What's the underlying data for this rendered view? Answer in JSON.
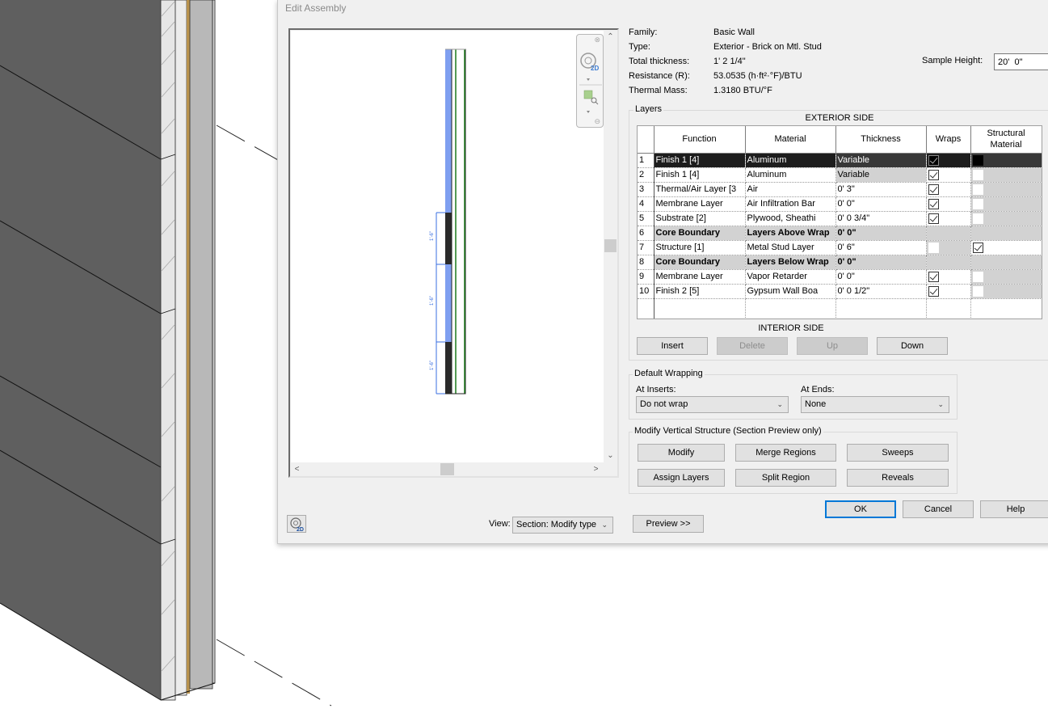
{
  "dialog": {
    "title": "Edit Assembly"
  },
  "properties": {
    "family_label": "Family:",
    "family_value": "Basic Wall",
    "type_label": "Type:",
    "type_value": "Exterior - Brick on Mtl. Stud",
    "total_thickness_label": "Total thickness:",
    "total_thickness_value": "1'  2 1/4\"",
    "resistance_label": "Resistance (R):",
    "resistance_value": "53.0535 (h·ft²·°F)/BTU",
    "thermal_mass_label": "Thermal Mass:",
    "thermal_mass_value": "1.3180 BTU/°F",
    "sample_height_label": "Sample Height:",
    "sample_height_value": "20'  0\""
  },
  "layers": {
    "group_label": "Layers",
    "exterior_label": "EXTERIOR SIDE",
    "interior_label": "INTERIOR SIDE",
    "columns": [
      "",
      "Function",
      "Material",
      "Thickness",
      "Wraps",
      "Structural Material"
    ],
    "rows": [
      {
        "num": "1",
        "function": "Finish 1 [4]",
        "material": "Aluminum",
        "thickness": "Variable",
        "wraps": true,
        "structural": false,
        "selected": true
      },
      {
        "num": "2",
        "function": "Finish 1 [4]",
        "material": "Aluminum",
        "thickness": "Variable",
        "wraps": true,
        "structural": false
      },
      {
        "num": "3",
        "function": "Thermal/Air Layer [3",
        "material": "Air",
        "thickness": "0'  3\"",
        "wraps": true,
        "structural": false
      },
      {
        "num": "4",
        "function": "Membrane Layer",
        "material": "Air Infiltration Bar",
        "thickness": "0'  0\"",
        "wraps": true,
        "structural": false
      },
      {
        "num": "5",
        "function": "Substrate [2]",
        "material": "Plywood, Sheathi",
        "thickness": "0'  0 3/4\"",
        "wraps": true,
        "structural": false
      },
      {
        "num": "6",
        "function": "Core Boundary",
        "material": "Layers Above Wrap",
        "thickness": "0'  0\"",
        "boundary": true
      },
      {
        "num": "7",
        "function": "Structure [1]",
        "material": "Metal Stud Layer",
        "thickness": "0'  6\"",
        "wraps": false,
        "structural": true
      },
      {
        "num": "8",
        "function": "Core Boundary",
        "material": "Layers Below Wrap",
        "thickness": "0'  0\"",
        "boundary": true
      },
      {
        "num": "9",
        "function": "Membrane Layer",
        "material": "Vapor Retarder",
        "thickness": "0'  0\"",
        "wraps": true,
        "structural": false
      },
      {
        "num": "10",
        "function": "Finish 2 [5]",
        "material": "Gypsum Wall Boa",
        "thickness": "0'  0 1/2\"",
        "wraps": true,
        "structural": false
      }
    ],
    "buttons": {
      "insert": "Insert",
      "delete": "Delete",
      "up": "Up",
      "down": "Down"
    }
  },
  "default_wrapping": {
    "group_label": "Default Wrapping",
    "at_inserts_label": "At Inserts:",
    "at_inserts_value": "Do not wrap",
    "at_ends_label": "At Ends:",
    "at_ends_value": "None"
  },
  "vertical_structure": {
    "group_label": "Modify Vertical Structure (Section Preview only)",
    "buttons": {
      "modify": "Modify",
      "merge_regions": "Merge Regions",
      "sweeps": "Sweeps",
      "assign_layers": "Assign Layers",
      "split_region": "Split Region",
      "reveals": "Reveals"
    }
  },
  "footer": {
    "ok": "OK",
    "cancel": "Cancel",
    "help": "Help",
    "preview": "Preview >>",
    "view_label": "View:",
    "view_value": "Section: Modify type"
  },
  "preview": {
    "dimension_labels": [
      "1'-6\"",
      "1'-6\"",
      "1'-6\""
    ],
    "navbar_2d_label": "2D"
  },
  "colors": {
    "accent": "#0078d7",
    "selected_row": "#1d1d1d",
    "boundary_row": "#d2d2d2",
    "region_blue": "#7f9ff0",
    "region_dark": "#2a2a2a",
    "wall_face": "#5f5f5f"
  }
}
